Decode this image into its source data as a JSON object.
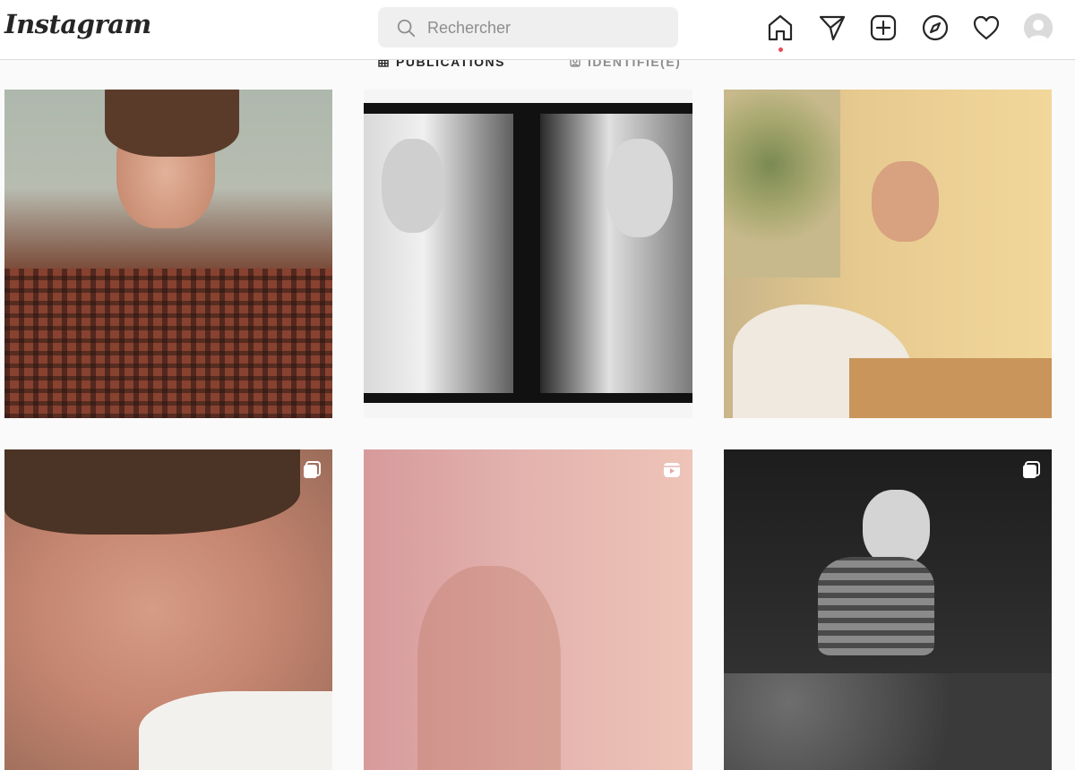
{
  "app": {
    "logo": "Instagram"
  },
  "search": {
    "placeholder": "Rechercher"
  },
  "nav": {
    "icons": [
      "home-icon",
      "direct-message-icon",
      "new-post-icon",
      "explore-icon",
      "activity-heart-icon",
      "profile-avatar"
    ],
    "notification_color": "#ed4956"
  },
  "profile_tabs": [
    {
      "label": "PUBLICATIONS",
      "icon": "grid-icon",
      "active": true
    },
    {
      "label": "IDENTIFIÉ(E)",
      "icon": "tagged-icon",
      "active": false
    }
  ],
  "posts": [
    {
      "type": "photo",
      "badge": null
    },
    {
      "type": "photo",
      "badge": null
    },
    {
      "type": "photo",
      "badge": null
    },
    {
      "type": "carousel",
      "badge": "carousel-icon"
    },
    {
      "type": "reel",
      "badge": "reels-icon"
    },
    {
      "type": "carousel",
      "badge": "carousel-icon"
    }
  ],
  "colors": {
    "text": "#262626",
    "muted": "#8e8e8e",
    "border": "#dbdbdb",
    "background": "#fafafa"
  }
}
